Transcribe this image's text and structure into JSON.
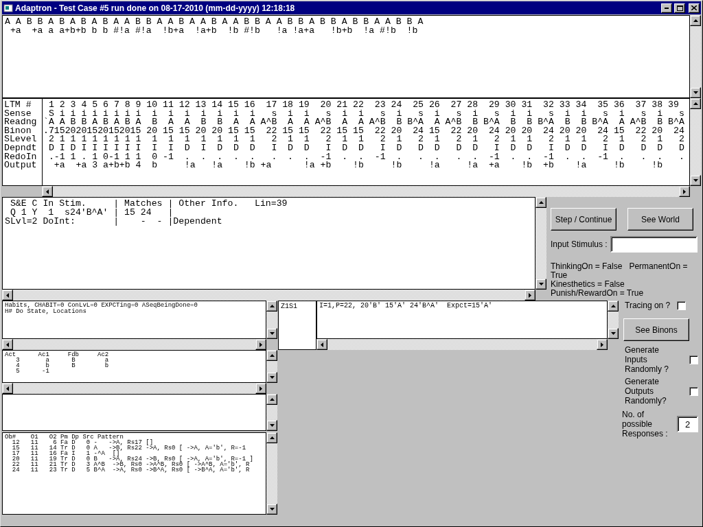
{
  "window": {
    "title": "Adaptron - Test Case #5 run done on 08-17-2010 (mm-dd-yyyy) 12:18:18"
  },
  "world_pane": {
    "lines": [
      "A A B B A B A B A B A A B B A A B A A B A A B B A A B B A B B A B B A A B B A",
      " +a  +a a a+b+b b b #!a #!a  !b+a  !a+b  !b #!b   !a !a+a   !b+b  !a #!b  !b"
    ]
  },
  "ltm_table": {
    "rows": [
      {
        "label": "LTM #",
        "text": " 1 2 3 4 5 6 7 8 9 10 11 12 13 14 15 16  17 18 19  20 21 22  23 24  25 26  27 28  29 30 31  32 33 34  35 36  37 38 39"
      },
      {
        "label": "Sense",
        "text": " S i i i i i i i i  i  i  i  i  i  i  i   s  i  i   s  i  i   s  i   s  i   s  i   s  i  i   s  i  i   s  i   s  i   s"
      },
      {
        "label": "Readng",
        "text": "`A A B B A B A B A  B  A  A  B  B  A  A A^B  A  A A^B  A  A A^B  B B^A  A A^B  B B^A  B  B B^A  B  B B^A  A A^B  B B^A"
      },
      {
        "label": "Binon",
        "text": ".71520201520152015 20 15 15 20 20 15 15  22 15 15  22 15 15  22 20  24 15  22 20  24 20 20  24 20 20  24 15  22 20  24"
      },
      {
        "label": "SLevel",
        "text": " 2 1 1 1 1 1 1 1 1  1  1  1  1  1  1  1   2  1  1   2  1  1   2  1   2  1   2  1   2  1  1   2  1  1   2  1   2  1   2"
      },
      {
        "label": "Depndt",
        "text": " D I D I I I I I I  I  I  D  I  D  D  D   I  D  D   I  D  D   I  D   D  D   D  D   I  D  D   I  D  D   I  D   D  D   D"
      },
      {
        "label": "RedoIn",
        "text": " .-1 1 . 1 0-1 1 1  0 -1  .  .  .  .  .   .  .  .  -1  .  .  -1  .   .  .   .  .  -1  .  .  -1  .  .  -1  .   .  .   ."
      },
      {
        "label": "Output",
        "text": "  +a  +a 3 a+b+b 4  b     !a   !a    !b +a      !a +b    !b     !b     !a     !a  +a    !b  +b    !a     !b     !b"
      }
    ]
  },
  "stimulus_pane": {
    "lines": [
      " S&E C In Stim.     | Matches | Other Info.   Lin=39",
      " Q 1 Y  1  s24'B^A' | 15 24   |",
      "SLvl=2 DoInt:       |    -  - |Dependent"
    ]
  },
  "controls_top": {
    "step_button": "Step / Continue",
    "world_button": "See World",
    "input_label": "Input Stimulus :",
    "status_lines": [
      "ThinkingOn = False   PermanentOn = True",
      "Kinesthetics = False   Punish/RewardOn = True"
    ]
  },
  "habits_pane": {
    "lines": [
      "Habits, CHABIT=0 ConLvL=0 EXPCTing=0 ASeqBeingDone=0",
      "H# Do State, Locations"
    ]
  },
  "acts_pane": {
    "lines": [
      "Act      Ac1     Fdb     Ac2",
      "   3       a      B        a",
      "   4       b      B        b",
      "   5      -1"
    ]
  },
  "objects_pane": {
    "lines": [
      "Ob#    O1   O2 Pm Dp Src Pattern",
      "  12   11    6 Fa D   0 -   ->A, Rs17 []",
      "  15   11   14 Tr D   0 A   ->B, Rs22 ->A, Rs0 [ ->A, A='b', R=-1",
      "  17   11   16 Fa I   1 -^A  []",
      "  20   11   19 Tr D   0 B   ->A, Rs24 ->B, Rs0 [ ->A, A='b', R=-1 ]",
      "  22   11   21 Tr D   3 A^B  ->B, Rs0 ->A^B, Rs0 [ ->A^B, A='b', R",
      "  24   11   23 Tr D   5 B^A  ->A, Rs0 ->B^A, Rs0 [ ->B^A, A='b', R"
    ]
  },
  "zone_pane": {
    "label": "Z1S1",
    "lines": [
      "I=1,P=22, 20'B' 15'A' 24'B^A'  Expct=15'A'"
    ]
  },
  "controls_bottom": {
    "tracing": {
      "label": "Tracing on ?",
      "checked": false
    },
    "binons_button": "See Binons",
    "generate_inputs": {
      "label": "Generate Inputs Randomly ?",
      "checked": false
    },
    "generate_outputs": {
      "label": "Generate Outputs Randomly?",
      "checked": false
    },
    "responses": {
      "label": "No. of possible Responses :",
      "value": "2"
    }
  }
}
